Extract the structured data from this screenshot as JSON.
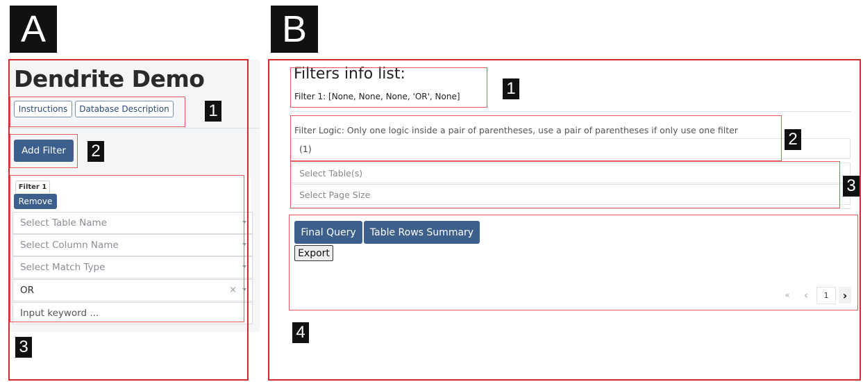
{
  "panels": {
    "a_label": "A",
    "b_label": "B"
  },
  "panel_a": {
    "app_title": "Dendrite Demo",
    "instructions_button": "Instructions",
    "db_description_button": "Database Description",
    "add_filter_button": "Add Filter",
    "filter_tab_label": "Filter 1",
    "remove_button": "Remove",
    "table_name_placeholder": "Select Table Name",
    "column_name_placeholder": "Select Column Name",
    "match_type_placeholder": "Select Match Type",
    "logic_value": "OR",
    "clear_symbol": "×",
    "keyword_placeholder": "Input keyword ...",
    "annotations": [
      "1",
      "2",
      "3"
    ]
  },
  "panel_b": {
    "filters_title": "Filters info list:",
    "filter_info": "Filter 1: [None, None, None, 'OR', None]",
    "filter_logic_label": "Filter Logic: Only one logic inside a pair of parentheses, use a pair of parentheses if only use one filter",
    "filter_logic_value": "(1)",
    "select_tables_placeholder": "Select Table(s)",
    "select_page_size_placeholder": "Select Page Size",
    "final_query_button": "Final Query",
    "table_rows_summary_button": "Table Rows Summary",
    "export_button": "Export",
    "pager": {
      "first": "«",
      "prev": "‹",
      "page": "1",
      "next": "›"
    },
    "annotations": [
      "1",
      "2",
      "3",
      "4"
    ]
  },
  "colors": {
    "annotation_border": "#e05a5a",
    "panel_border": "#d42a2a",
    "primary_button": "#3d5f8c"
  }
}
